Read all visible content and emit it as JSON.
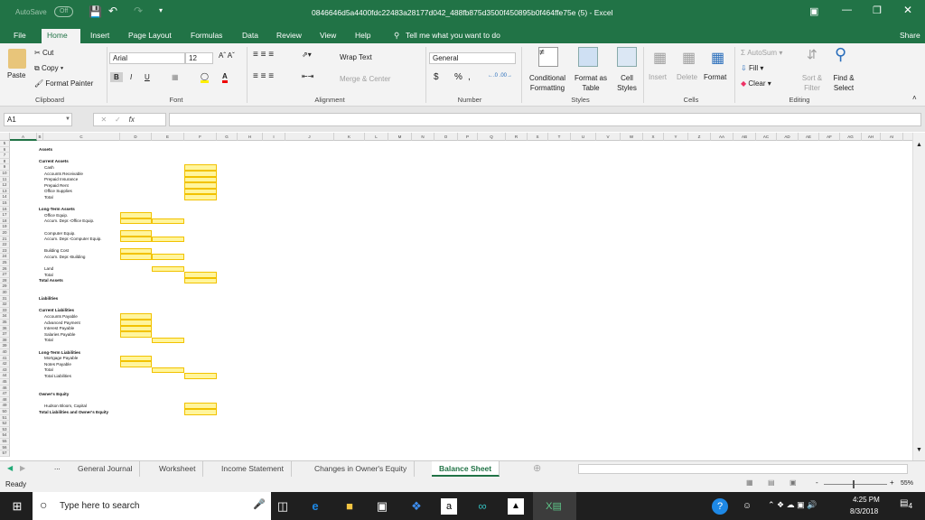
{
  "titlebar": {
    "autosave_label": "AutoSave",
    "autosave_state": "Off",
    "title": "0846646d5a4400fdc22483a28177d042_488fb875d3500f450895b0f464ffe75e (5)  -  Excel"
  },
  "ribbon_tabs": [
    "File",
    "Home",
    "Insert",
    "Page Layout",
    "Formulas",
    "Data",
    "Review",
    "View",
    "Help"
  ],
  "tell_me": "Tell me what you want to do",
  "share": "Share",
  "clipboard": {
    "paste": "Paste",
    "cut": "Cut",
    "copy": "Copy",
    "format_painter": "Format Painter",
    "group": "Clipboard"
  },
  "font": {
    "name": "Arial",
    "size": "12",
    "bold": "B",
    "italic": "I",
    "underline": "U",
    "group": "Font"
  },
  "alignment": {
    "wrap": "Wrap Text",
    "merge": "Merge & Center",
    "group": "Alignment"
  },
  "number": {
    "format": "General",
    "currency": "$",
    "percent": "%",
    "comma": ",",
    "group": "Number"
  },
  "styles": {
    "conditional": "Conditional Formatting",
    "format_table": "Format as Table",
    "cell_styles": "Cell Styles",
    "group": "Styles"
  },
  "cells": {
    "insert": "Insert",
    "delete": "Delete",
    "format": "Format",
    "group": "Cells"
  },
  "editing": {
    "autosum": "AutoSum",
    "fill": "Fill",
    "clear": "Clear",
    "sort": "Sort & Filter",
    "find": "Find & Select",
    "group": "Editing"
  },
  "formula_bar": {
    "name_box": "A1",
    "formula": "",
    "fx": "fx"
  },
  "columns": [
    "A",
    "B",
    "C",
    "D",
    "E",
    "F",
    "G",
    "H",
    "I",
    "J",
    "K",
    "L",
    "M",
    "N",
    "O",
    "P",
    "Q",
    "R",
    "S",
    "T",
    "U",
    "V",
    "W",
    "X",
    "Y",
    "Z",
    "AA",
    "AB",
    "AC",
    "AD",
    "AE",
    "AF",
    "AG",
    "AH",
    "AI"
  ],
  "first_row": 5,
  "last_row": 57,
  "labels": [
    {
      "row": 6,
      "text": "Assets",
      "bold": true,
      "indent": false
    },
    {
      "row": 8,
      "text": "Current Assets",
      "bold": true,
      "indent": false
    },
    {
      "row": 9,
      "text": "Cash",
      "bold": false,
      "indent": true
    },
    {
      "row": 10,
      "text": "Accounts Receivable",
      "bold": false,
      "indent": true
    },
    {
      "row": 11,
      "text": "Prepaid Insurance",
      "bold": false,
      "indent": true
    },
    {
      "row": 12,
      "text": "Prepaid Rent",
      "bold": false,
      "indent": true
    },
    {
      "row": 13,
      "text": "Office Supplies",
      "bold": false,
      "indent": true
    },
    {
      "row": 14,
      "text": "Total",
      "bold": false,
      "indent": true
    },
    {
      "row": 16,
      "text": "Long-Term Assets",
      "bold": true,
      "indent": false
    },
    {
      "row": 17,
      "text": "Office Equip.",
      "bold": false,
      "indent": true
    },
    {
      "row": 18,
      "text": "Accum. Depr.-Office Equip.",
      "bold": false,
      "indent": true
    },
    {
      "row": 20,
      "text": "Computer Equip.",
      "bold": false,
      "indent": true
    },
    {
      "row": 21,
      "text": "Accum. Depr.-Computer Equip.",
      "bold": false,
      "indent": true
    },
    {
      "row": 23,
      "text": "Building Cost",
      "bold": false,
      "indent": true
    },
    {
      "row": 24,
      "text": "Accum. Depr.-Building",
      "bold": false,
      "indent": true
    },
    {
      "row": 26,
      "text": "Land",
      "bold": false,
      "indent": true
    },
    {
      "row": 27,
      "text": "Total",
      "bold": false,
      "indent": true
    },
    {
      "row": 28,
      "text": "Total Assets",
      "bold": true,
      "indent": false
    },
    {
      "row": 31,
      "text": "Liabilities",
      "bold": true,
      "indent": false
    },
    {
      "row": 33,
      "text": "Current Liabilities",
      "bold": true,
      "indent": false
    },
    {
      "row": 34,
      "text": "Accounts Payable",
      "bold": false,
      "indent": true
    },
    {
      "row": 35,
      "text": "Advanced Payment",
      "bold": false,
      "indent": true
    },
    {
      "row": 36,
      "text": "Interest Payable",
      "bold": false,
      "indent": true
    },
    {
      "row": 37,
      "text": "Salaries Payable",
      "bold": false,
      "indent": true
    },
    {
      "row": 38,
      "text": "Total",
      "bold": false,
      "indent": true
    },
    {
      "row": 40,
      "text": "Long-Term Liabilities",
      "bold": true,
      "indent": false
    },
    {
      "row": 41,
      "text": "Mortgage Payable",
      "bold": false,
      "indent": true
    },
    {
      "row": 42,
      "text": "Notes Payable",
      "bold": false,
      "indent": true
    },
    {
      "row": 43,
      "text": "Total",
      "bold": false,
      "indent": true
    },
    {
      "row": 44,
      "text": "Total Liabilities",
      "bold": false,
      "indent": true
    },
    {
      "row": 47,
      "text": "Owner's Equity",
      "bold": true,
      "indent": false
    },
    {
      "row": 49,
      "text": "Hudson Bloom, Capital",
      "bold": false,
      "indent": true
    },
    {
      "row": 50,
      "text": "Total Liabilities and Owner's Equity",
      "bold": true,
      "indent": false
    }
  ],
  "input_cells": [
    {
      "col": "F",
      "rows": [
        9,
        10,
        11,
        12,
        13,
        14,
        27,
        28,
        44,
        49,
        50
      ]
    },
    {
      "col": "D",
      "rows": [
        17,
        18,
        20,
        21,
        23,
        24,
        34,
        35,
        36,
        37,
        41,
        42
      ]
    },
    {
      "col": "E",
      "rows": [
        18,
        21,
        24,
        26,
        38,
        43
      ]
    }
  ],
  "sheet_tabs": [
    "General Journal",
    "Worksheet",
    "Income Statement",
    "Changes in Owner's Equity",
    "Balance Sheet"
  ],
  "active_sheet": "Balance Sheet",
  "status": {
    "ready": "Ready",
    "zoom": "55%"
  },
  "taskbar": {
    "search": "Type here to search",
    "time": "4:25 PM",
    "date": "8/3/2018",
    "notifications": "4"
  },
  "colors": {
    "excel_green": "#217346",
    "input_fill": "#fff59d",
    "input_border": "#f2c200"
  }
}
